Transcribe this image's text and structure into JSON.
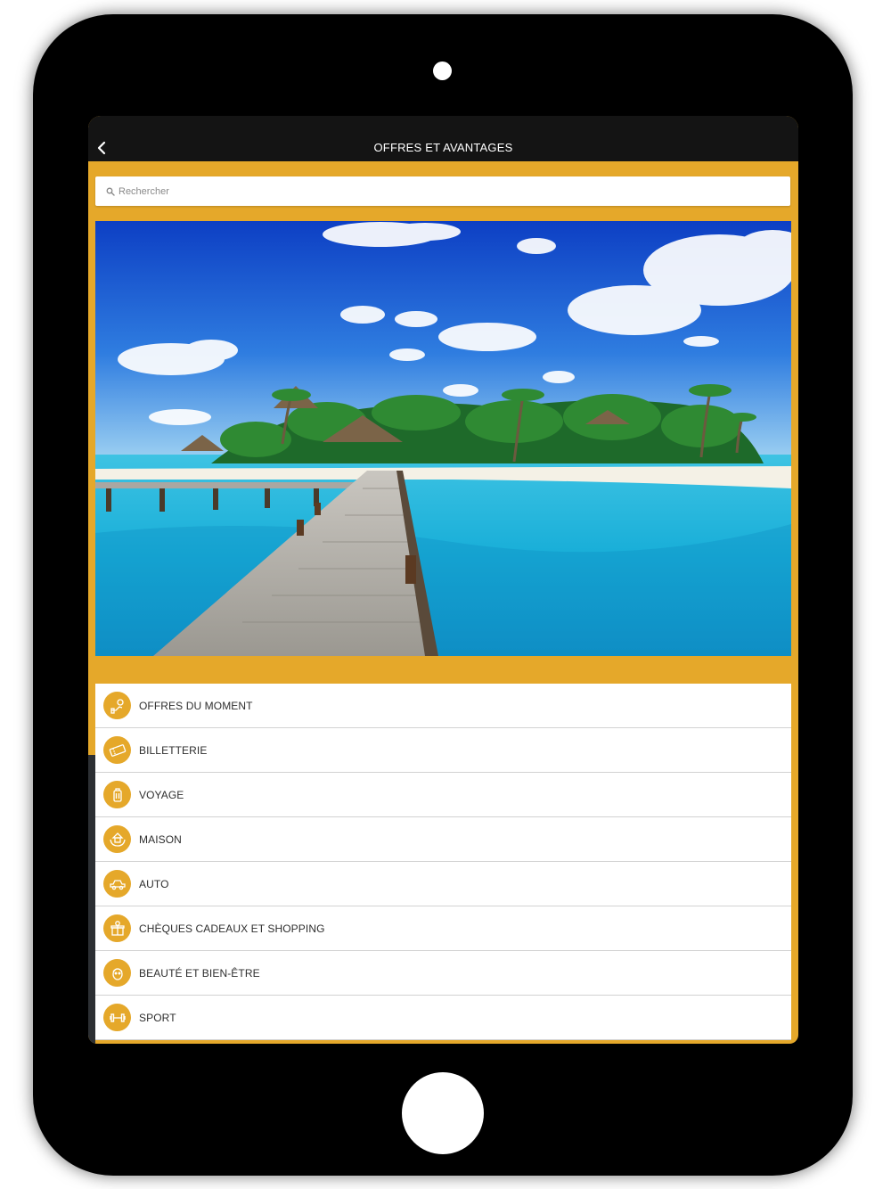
{
  "navbar": {
    "title": "OFFRES ET AVANTAGES",
    "back_icon": "chevron-left-icon"
  },
  "search": {
    "placeholder": "Rechercher",
    "icon": "search-icon"
  },
  "banner": {
    "description_icon": "tropical-island-photo"
  },
  "categories": [
    {
      "label": "OFFRES DU MOMENT",
      "icon": "offer-icon"
    },
    {
      "label": "BILLETTERIE",
      "icon": "ticket-icon"
    },
    {
      "label": "VOYAGE",
      "icon": "suitcase-icon"
    },
    {
      "label": "MAISON",
      "icon": "house-hands-icon"
    },
    {
      "label": "AUTO",
      "icon": "car-icon"
    },
    {
      "label": "CHÈQUES CADEAUX ET SHOPPING",
      "icon": "gift-icon"
    },
    {
      "label": "BEAUTÉ ET BIEN-ÊTRE",
      "icon": "beauty-face-icon"
    },
    {
      "label": "SPORT",
      "icon": "dumbbell-icon"
    }
  ],
  "colors": {
    "accent": "#e5a82a",
    "navbar": "#141414",
    "device": "#000000"
  }
}
